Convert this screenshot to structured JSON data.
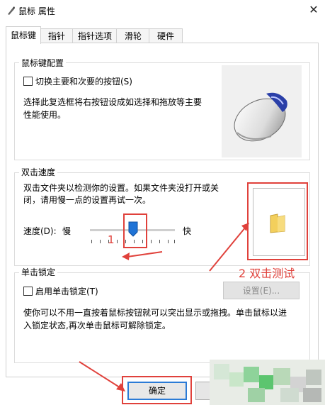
{
  "window": {
    "title": "鼠标 属性",
    "close_glyph": "✕"
  },
  "tabs": [
    {
      "label": "鼠标键",
      "active": true
    },
    {
      "label": "指针"
    },
    {
      "label": "指针选项"
    },
    {
      "label": "滑轮"
    },
    {
      "label": "硬件"
    }
  ],
  "button_config": {
    "group_title": "鼠标键配置",
    "swap_checkbox_label": "切换主要和次要的按钮(S)",
    "swap_checked": false,
    "description": [
      "选择此复选框将右按钮设成如选择和拖放等主要",
      "性能使用。"
    ]
  },
  "double_click": {
    "group_title": "双击速度",
    "description": [
      "双击文件夹以检测你的设置。如果文件夹没打开或关",
      "闭，请用慢一点的设置再试一次。"
    ],
    "speed_label": "速度(D):",
    "slow_label": "慢",
    "fast_label": "快",
    "speed_level": 0.5
  },
  "click_lock": {
    "group_title": "单击锁定",
    "checkbox_label": "启用单击锁定(T)",
    "checked": false,
    "settings_button": "设置(E)...",
    "description": [
      "使你可以不用一直按着鼠标按钮就可以突出显示或拖拽。单击鼠标以进",
      "入锁定状态,再次单击鼠标可解除锁定。"
    ]
  },
  "buttons": {
    "ok": "确定"
  },
  "annotations": {
    "step1": "1",
    "step2": "2 双击测试",
    "color": "#e0413b"
  }
}
